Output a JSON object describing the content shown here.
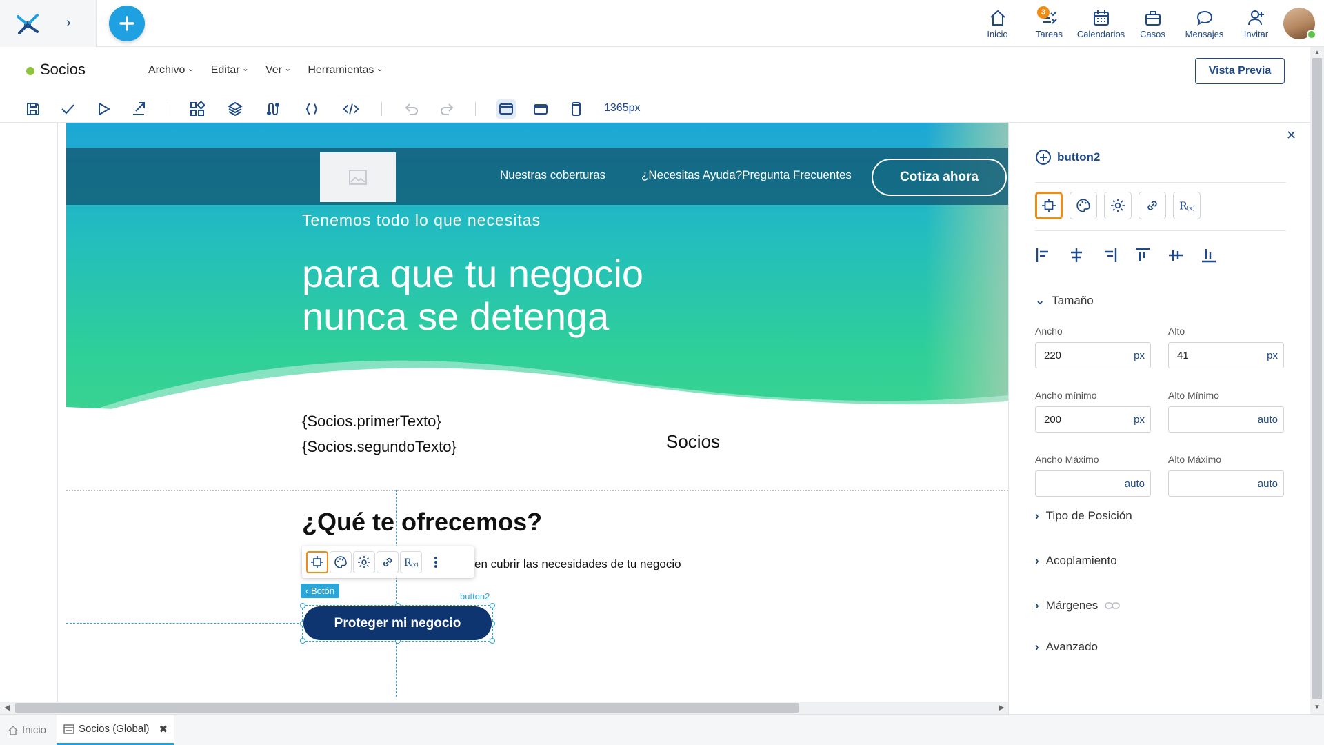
{
  "topbar": {
    "nav": [
      {
        "label": "Inicio",
        "icon": "home-icon"
      },
      {
        "label": "Tareas",
        "icon": "tasks-icon",
        "badge": "3"
      },
      {
        "label": "Calendarios",
        "icon": "calendar-icon"
      },
      {
        "label": "Casos",
        "icon": "briefcase-icon"
      },
      {
        "label": "Mensajes",
        "icon": "chat-icon"
      },
      {
        "label": "Invitar",
        "icon": "add-user-icon"
      }
    ]
  },
  "titlebar": {
    "title": "Socios",
    "menus": [
      "Archivo",
      "Editar",
      "Ver",
      "Herramientas"
    ],
    "preview_label": "Vista Previa"
  },
  "toolbar": {
    "width_label": "1365px"
  },
  "canvas": {
    "nav_links": [
      "Nuestras coberturas",
      "¿Necesitas Ayuda?Pregunta Frecuentes"
    ],
    "cta_label": "Cotiza ahora",
    "hero_sub": "Tenemos todo lo que necesitas",
    "hero_title_1": "para que tu negocio",
    "hero_title_2": "nunca se detenga",
    "field_1": "{Socios.primerTexto}",
    "field_2": "{Socios.segundoTexto}",
    "field_socios": "Socios",
    "offer_title": "¿Qué te ofrecemos?",
    "offer_text": "en cubrir las necesidades de tu negocio",
    "boton_tag": "Botón",
    "selected_name": "button2",
    "button_label": "Proteger mi negocio"
  },
  "panel": {
    "component": "button2",
    "section_size": "Tamaño",
    "ancho_label": "Ancho",
    "ancho_value": "220",
    "alto_label": "Alto",
    "alto_value": "41",
    "ancho_min_label": "Ancho mínimo",
    "ancho_min_value": "200",
    "alto_min_label": "Alto Mínimo",
    "ancho_max_label": "Ancho Máximo",
    "alto_max_label": "Alto Máximo",
    "unit": "px",
    "auto": "auto",
    "sections": [
      "Tipo de Posición",
      "Acoplamiento",
      "Márgenes",
      "Avanzado"
    ]
  },
  "bottom_tabs": [
    {
      "label": "Inicio",
      "icon": "home-icon"
    },
    {
      "label": "Socios (Global)",
      "icon": "form-icon"
    }
  ],
  "colors": {
    "accent": "#1fa0e0",
    "brand_dark": "#1e4a8a",
    "highlight": "#f08c14",
    "button": "#0f3570",
    "status_dot": "#8cc43c"
  }
}
